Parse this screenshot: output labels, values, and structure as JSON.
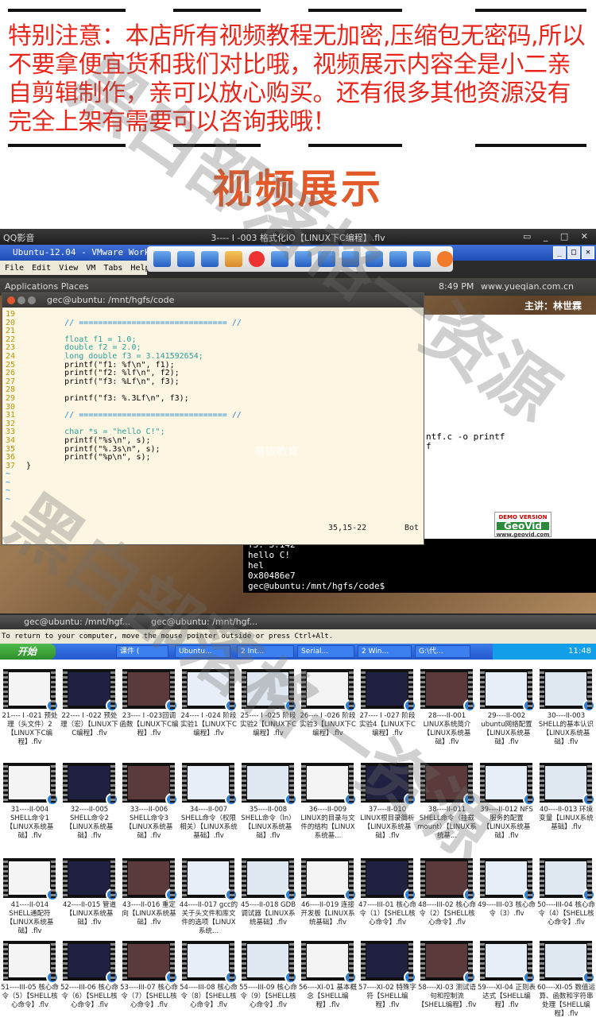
{
  "notice": {
    "text": "特别注意：本店所有视频教程无加密,压缩包无密码,所以不要拿便宜货和我们对比哦，视频展示内容全是小二亲自剪辑制作，亲可以放心购买。还有很多其他资源没有完全上架有需要可以咨询我哦！",
    "color": "#e8261c"
  },
  "section_title": "视频展示",
  "player": {
    "app_name": "QQ影音",
    "video_title": "3---- I -003 格式化IO【LINUX下C编程】.flv",
    "vm_title": "Ubuntu-12.04 - VMware Workst",
    "vm_menu": [
      "File",
      "Edit",
      "View",
      "VM",
      "Tabs",
      "Help"
    ],
    "ubuntu_bar": {
      "apps": "Applications Places",
      "time": "8:49 PM",
      "url": "www.yueqian.com.cn"
    },
    "speaker": "主讲：林世霖",
    "editor_title": "gec@ubuntu: /mnt/hgfs/code",
    "code_lines": [
      {
        "n": "19",
        "t": ""
      },
      {
        "n": "20",
        "t": "        // =============================== //"
      },
      {
        "n": "21",
        "t": ""
      },
      {
        "n": "22",
        "t": "        float f1 = 1.0;"
      },
      {
        "n": "23",
        "t": "        double f2 = 2.0;"
      },
      {
        "n": "24",
        "t": "        long double f3 = 3.141592654;"
      },
      {
        "n": "25",
        "t": "        printf(\"f1: %f\\n\", f1);"
      },
      {
        "n": "26",
        "t": "        printf(\"f2: %lf\\n\", f2);"
      },
      {
        "n": "27",
        "t": "        printf(\"f3: %Lf\\n\", f3);"
      },
      {
        "n": "28",
        "t": ""
      },
      {
        "n": "29",
        "t": "        printf(\"f3: %.3Lf\\n\", f3);"
      },
      {
        "n": "30",
        "t": ""
      },
      {
        "n": "31",
        "t": "        // =============================== //"
      },
      {
        "n": "32",
        "t": ""
      },
      {
        "n": "33",
        "t": "        char *s = \"hello C!\";"
      },
      {
        "n": "34",
        "t": "        printf(\"%s\\n\", s);"
      },
      {
        "n": "35",
        "t": "        printf(\"%.3s\\n\", s);"
      },
      {
        "n": "36",
        "t": "        printf(\"%p\\n\", s);"
      },
      {
        "n": "37",
        "t": "}"
      },
      {
        "n": "~",
        "t": ""
      },
      {
        "n": "~",
        "t": ""
      },
      {
        "n": "~",
        "t": ""
      },
      {
        "n": "~",
        "t": ""
      }
    ],
    "editor_status": "35,15-22",
    "editor_status2": "Bot",
    "back_cmd_1": "ntf.c -o printf",
    "back_cmd_2": "f",
    "terminal_output": [
      "f3: 3.142",
      "hello C!",
      "hel",
      "0x80486e7",
      "gec@ubuntu:/mnt/hgfs/code$ "
    ],
    "watermark_logo": "粤嵌教育",
    "geovid": {
      "demo": "DEMO VERSION",
      "name": "GeoVid",
      "url": "www.geovid.com"
    },
    "taskbar_items": [
      "gec@ubuntu: /mnt/hgf...",
      "gec@ubuntu: /mnt/hgf..."
    ],
    "vm_hint": "To return to your computer, move the mouse pointer outside or press Ctrl+Alt."
  },
  "win_taskbar": {
    "start": "开始",
    "tasks": [
      "课件 (",
      "Ubuntu...",
      "2 Int...",
      "Serial...",
      "2 Win...",
      "G:\\代..."
    ],
    "clock": "11:48"
  },
  "thumbnails": [
    "21---- I -021 预处理（头文件）2【LINUX下C编程】.flv",
    "22---- I -022 预处理（宏）【LINUX下C编程】.flv",
    "23---- I -023回调函数【LINUX下C编程】.flv",
    "24---- I -024 阶段实验1【LINUX下C编程】.flv",
    "25---- I -025 阶段实验2【LINUX下C编程】.flv",
    "26---- I -026 阶段实验3【LINUX下C编程】.flv",
    "27---- I -027 阶段实验4【LINUX下C编程】.flv",
    "28----II-001 LINUX系统简介【LINUX系统基础】.flv",
    "29----II-002 ubuntu网络配置【LINUX系统基础】.flv",
    "30----II-003 SHELL的基本认识【LINUX系统基础】.flv",
    "31----II-004 SHELL命令1【LINUX系统基础】.flv",
    "32----II-005 SHELL命令2【LINUX系统基础】.flv",
    "33----II-006 SHELL命令3【LINUX系统基础】.flv",
    "34----II-007 SHELL命令（权限相关）【LINUX系统基础】.flv",
    "35----II-008 SHELL命令（ln）【LINUX系统基础】.flv",
    "36----II-009 LINUX的目录与文件的结构【LINUX系统基...",
    "37----II-010 LINUX根目录简析【LINUX系统基础】.flv",
    "38----II-011 SHELL命令（挂载mount）【LINUX系统基...",
    "39----II-012 NFS服务的配置【LINUX系统基础】.flv",
    "40----II-013 环境变量【LINUX系统基础】.flv",
    "41----II-014 SHELL通配符【LINUX系统基础】.flv",
    "42----II-015 管道【LINUX系统基础】.flv",
    "43----II-016 重定向【LINUX系统基础】.flv",
    "44----II-017 gcc的关于头文件和库文件的选项【LINUX系统...",
    "45----II-018 GDB调试器【LINUX系统基础】.flv",
    "46----II-019 连接开发板【LINUX系统基础】.flv",
    "47----III-01 核心命令（1）【SHELL核心命令】.flv",
    "48----III-02 核心命令（2）【SHELL核心命令】.flv",
    "49----III-03 核心命令（3）.flv",
    "50----III-04 核心命令（4）【SHELL核心命令】.flv",
    "51----III-05 核心命令（5）【SHELL核心命令】.flv",
    "52----III-06 核心命令（6）【SHELL核心命令】.flv",
    "53----III-07 核心命令（7）【SHELL核心命令】.flv",
    "54----III-08 核心命令（8）【SHELL核心命令】.flv",
    "55----III-09 核心命令（9）【SHELL核心命令】.flv",
    "56----XI-01 基本概念【SHELL编程】.flv",
    "57----XI-02 特殊字符【SHELL编程】.flv",
    "58----XI-03 测试语句和控制流【SHELL编程】.flv",
    "59----XI-04 正则表达式【SHELL编程】.flv",
    "60----XI-05 数值运算、函数和字符串处理【SHELL编程】.flv"
  ],
  "watermark": "黑白部落格一资源"
}
